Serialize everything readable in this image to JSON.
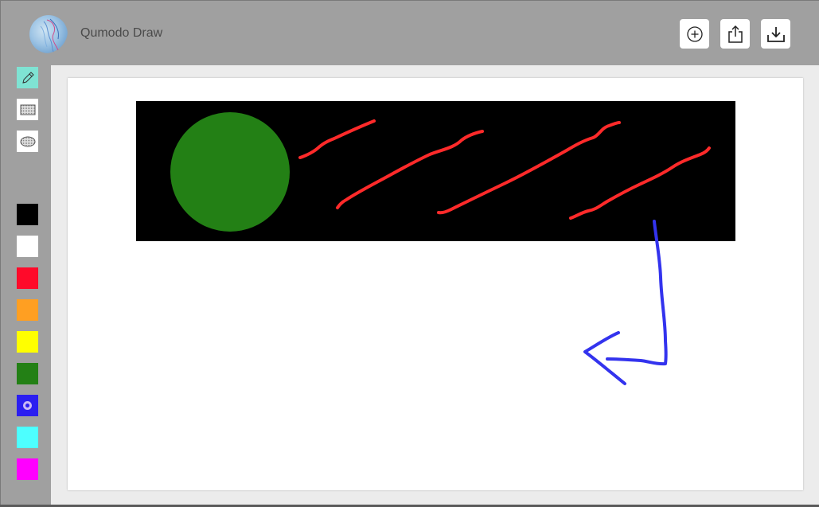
{
  "header": {
    "app_title": "Qumodo Draw",
    "buttons": [
      {
        "name": "new-drawing-button",
        "icon": "plus-circle-icon"
      },
      {
        "name": "share-button",
        "icon": "share-icon"
      },
      {
        "name": "download-button",
        "icon": "download-icon"
      }
    ]
  },
  "tools": [
    {
      "name": "pencil-tool",
      "icon": "pencil-icon",
      "active": true
    },
    {
      "name": "rectangle-tool",
      "icon": "rectangle-icon",
      "active": false
    },
    {
      "name": "ellipse-tool",
      "icon": "ellipse-icon",
      "active": false
    }
  ],
  "palette": {
    "colors": [
      "#000000",
      "#ffffff",
      "#ff0a2a",
      "#ff9f22",
      "#ffff00",
      "#238015",
      "#2b1ef0",
      "#4dffff",
      "#ff00ff"
    ],
    "selected": "#2b1ef0"
  },
  "canvas": {
    "background": "#ffffff",
    "shapes": [
      {
        "type": "rectangle",
        "fill": "#000000"
      },
      {
        "type": "circle",
        "fill": "#238015"
      },
      {
        "type": "stroke",
        "color": "#ff2a2a"
      },
      {
        "type": "stroke",
        "color": "#ff2a2a"
      },
      {
        "type": "stroke",
        "color": "#ff2a2a"
      },
      {
        "type": "stroke",
        "color": "#ff2a2a"
      },
      {
        "type": "stroke",
        "color": "#3333ee"
      }
    ]
  }
}
